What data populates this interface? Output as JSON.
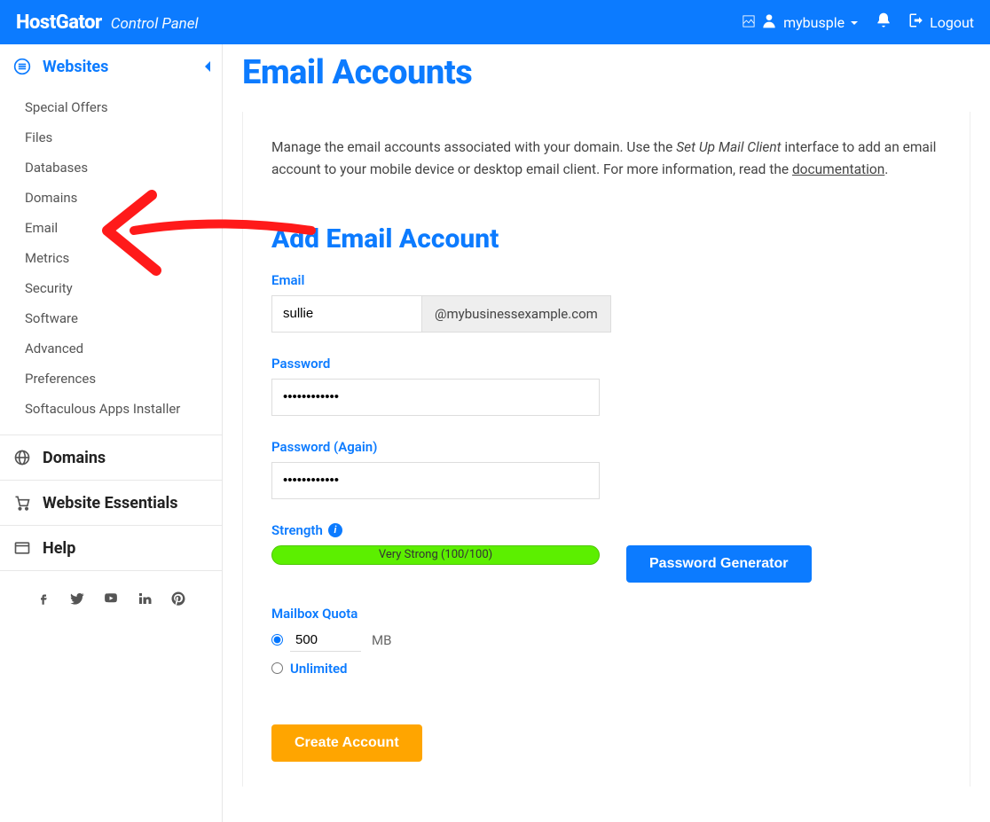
{
  "header": {
    "brand": "HostGator",
    "brand_sub": "Control Panel",
    "username": "mybusple",
    "logout": "Logout"
  },
  "sidebar": {
    "sections": [
      {
        "label": "Websites",
        "active": true,
        "icon": "menu-circle",
        "items": [
          "Special Offers",
          "Files",
          "Databases",
          "Domains",
          "Email",
          "Metrics",
          "Security",
          "Software",
          "Advanced",
          "Preferences",
          "Softaculous Apps Installer"
        ]
      },
      {
        "label": "Domains",
        "icon": "globe",
        "items": []
      },
      {
        "label": "Website Essentials",
        "icon": "cart",
        "items": []
      },
      {
        "label": "Help",
        "icon": "window",
        "items": []
      }
    ]
  },
  "page": {
    "title": "Email Accounts",
    "intro_pre": "Manage the email accounts associated with your domain. Use the ",
    "intro_em": "Set Up Mail Client",
    "intro_mid": " interface to add an email account to your mobile device or desktop email client. For more information, read the ",
    "intro_link": "documentation",
    "intro_post": "."
  },
  "form": {
    "section_title": "Add Email Account",
    "email_label": "Email",
    "email_value": "sullie",
    "domain": "@mybusinessexample.com",
    "password_label": "Password",
    "password_value": "••••••••••••",
    "password2_label": "Password (Again)",
    "password2_value": "••••••••••••",
    "strength_label": "Strength",
    "strength_text": "Very Strong (100/100)",
    "pw_gen_btn": "Password Generator",
    "quota_label": "Mailbox Quota",
    "quota_value": "500",
    "quota_unit": "MB",
    "unlimited": "Unlimited",
    "create_btn": "Create Account"
  },
  "colors": {
    "primary": "#0c7bff",
    "accent_orange": "#ffa500",
    "strength_green": "#5cef00"
  }
}
